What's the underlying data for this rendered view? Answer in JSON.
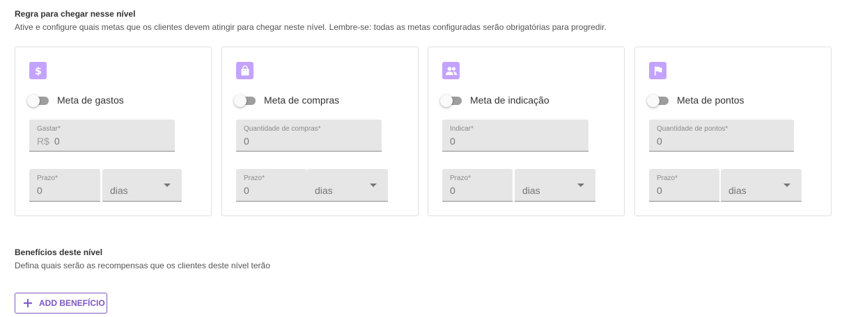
{
  "rules": {
    "title": "Regra para chegar nesse nível",
    "description": "Ative e configure quais metas que os clientes devem atingir para chegar neste nível. Lembre-se: todas as metas configuradas serão obrigatórias para progredir.",
    "cards": [
      {
        "icon": "dollar-icon",
        "toggle_label": "Meta de gastos",
        "enabled": false,
        "field_label": "Gastar*",
        "field_prefix": "R$",
        "field_value": "0",
        "term_label": "Prazo*",
        "term_value": "0",
        "term_unit": "dias"
      },
      {
        "icon": "shopping-bag-icon",
        "toggle_label": "Meta de compras",
        "enabled": false,
        "field_label": "Quantidade de compras*",
        "field_value": "0",
        "term_label": "Prazo*",
        "term_value": "0",
        "term_unit": "dias"
      },
      {
        "icon": "people-icon",
        "toggle_label": "Meta de indicação",
        "enabled": false,
        "field_label": "Indicar*",
        "field_value": "0",
        "term_label": "Prazo*",
        "term_value": "0",
        "term_unit": "dias"
      },
      {
        "icon": "flag-icon",
        "toggle_label": "Meta de pontos",
        "enabled": false,
        "field_label": "Quantidade de pontos*",
        "field_value": "0",
        "term_label": "Prazo*",
        "term_value": "0",
        "term_unit": "dias"
      }
    ]
  },
  "benefits": {
    "title": "Benefícios deste nível",
    "description": "Defina quais serão as recompensas que os clientes deste nível terão",
    "add_button_label": "ADD BENEFÍCIO"
  },
  "colors": {
    "accent": "#7e57c2",
    "icon_bg": "#c4a3ff",
    "field_bg": "#e6e6e6"
  }
}
